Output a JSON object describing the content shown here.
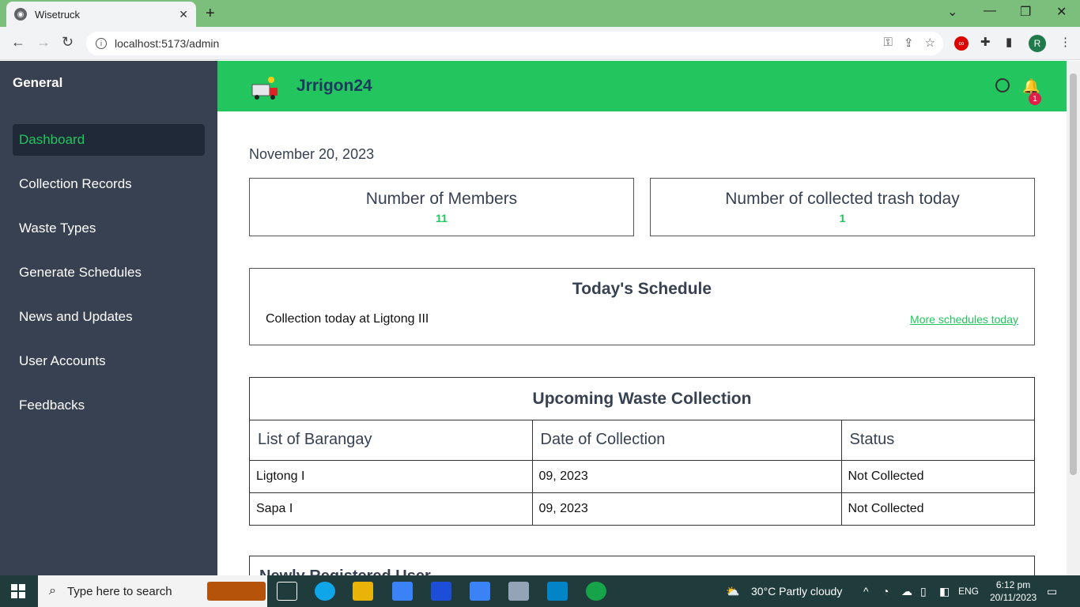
{
  "browser": {
    "tab_title": "Wisetruck",
    "tab_close": "✕",
    "new_tab": "+",
    "url": "localhost:5173/admin"
  },
  "sidebar": {
    "title": "General",
    "items": [
      {
        "label": "Dashboard"
      },
      {
        "label": "Collection Records"
      },
      {
        "label": "Waste Types"
      },
      {
        "label": "Generate Schedules"
      },
      {
        "label": "News and Updates"
      },
      {
        "label": "User Accounts"
      },
      {
        "label": "Feedbacks"
      }
    ]
  },
  "header": {
    "brand": "Jrrigon24",
    "notification_count": "1"
  },
  "dashboard": {
    "date": "November 20, 2023",
    "cards": [
      {
        "title": "Number of Members",
        "value": "11"
      },
      {
        "title": "Number of collected trash today",
        "value": "1"
      }
    ],
    "schedule": {
      "title": "Today's Schedule",
      "line": "Collection today at Ligtong III",
      "more_link": "More schedules today"
    },
    "upcoming": {
      "title": "Upcoming Waste Collection",
      "columns": [
        "List of Barangay",
        "Date of Collection",
        "Status"
      ],
      "rows": [
        [
          "Ligtong I",
          "09, 2023",
          "Not Collected"
        ],
        [
          "Sapa I",
          "09, 2023",
          "Not Collected"
        ]
      ]
    },
    "new_registered_title": "Newly Registered User"
  },
  "taskbar": {
    "search_placeholder": "Type here to search",
    "weather": "30°C  Partly cloudy",
    "language": "ENG",
    "time": "6:12 pm",
    "date": "20/11/2023"
  },
  "colors": {
    "accent_green": "#22c55e",
    "sidebar_bg": "#374151",
    "sidebar_active_bg": "#1f2937"
  }
}
